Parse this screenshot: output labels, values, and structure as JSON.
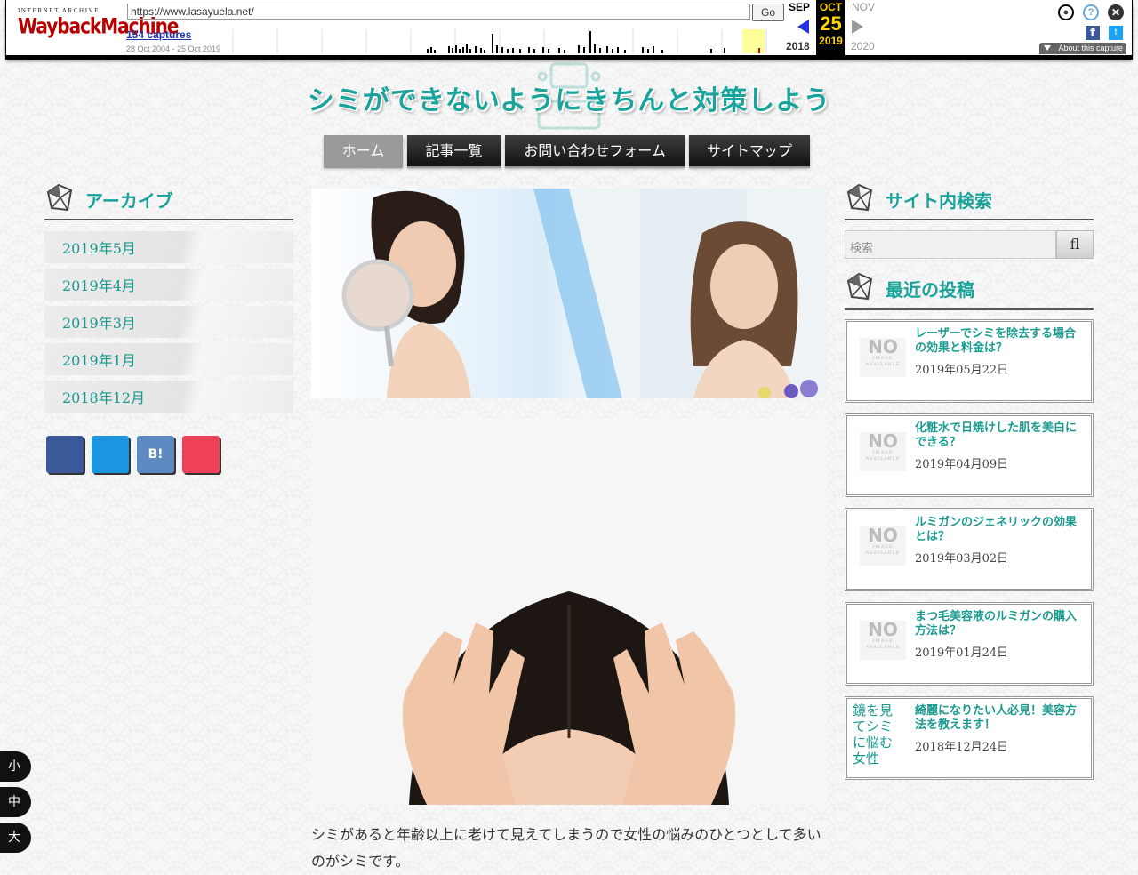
{
  "wayback": {
    "url": "https://www.lasayuela.net/",
    "go_label": "Go",
    "logo_top": "INTERNET ARCHIVE",
    "logo_main": "WaybackMachine",
    "captures": "154 captures",
    "range": "28 Oct 2004 - 25 Oct 2019",
    "prev_month": "SEP",
    "cur_month": "OCT",
    "cur_day": "25",
    "cur_year": "2019",
    "next_month": "NOV",
    "prev_year": "2018",
    "next_year": "2020",
    "about": "About this capture",
    "fb_glyph": "f",
    "tw_glyph": "t",
    "help_glyph": "?",
    "close_glyph": "✕",
    "user_glyph": "●"
  },
  "site": {
    "title": "シミができないようにきちんと対策しよう",
    "nav": [
      "ホーム",
      "記事一覧",
      "お問い合わせフォーム",
      "サイトマップ"
    ]
  },
  "archives": {
    "heading": "アーカイブ",
    "icon_glyph": "",
    "items": [
      "2019年5月",
      "2019年4月",
      "2019年3月",
      "2019年1月",
      "2018年12月"
    ]
  },
  "share": {
    "facebook": "",
    "twitter": "",
    "hatena": "B!",
    "pocket": ""
  },
  "search": {
    "heading": "サイト内検索",
    "placeholder": "検索",
    "button": "fl"
  },
  "recent": {
    "heading": "最近の投稿",
    "date_icon": "",
    "noimage_big": "NO",
    "noimage_small": "IMAGE AVAILABLE",
    "posts": [
      {
        "title": "レーザーでシミを除去する場合の効果と料金は？",
        "date": "2019年05月22日"
      },
      {
        "title": "化粧水で日焼けした肌を美白にできる？",
        "date": "2019年04月09日"
      },
      {
        "title": "ルミガンのジェネリックの効果とは？",
        "date": "2019年03月02日"
      },
      {
        "title": "まつ毛美容液のルミガンの購入方法は？",
        "date": "2019年01月24日"
      },
      {
        "title": "綺麗になりたい人必見！美容方法を教えます！",
        "date": "2018年12月24日",
        "thumb_alt": "鏡を見てシミに悩む女性"
      }
    ]
  },
  "article": {
    "intro": "シミがあると年齢以上に老けて見えてしまうので女性の悩みのひとつとして多いのがシミです。"
  },
  "font_size": [
    "小",
    "中",
    "大"
  ],
  "colors": {
    "accent": "#1aa39a",
    "nav_dark": "#222222",
    "wayback_red": "#b80000"
  }
}
